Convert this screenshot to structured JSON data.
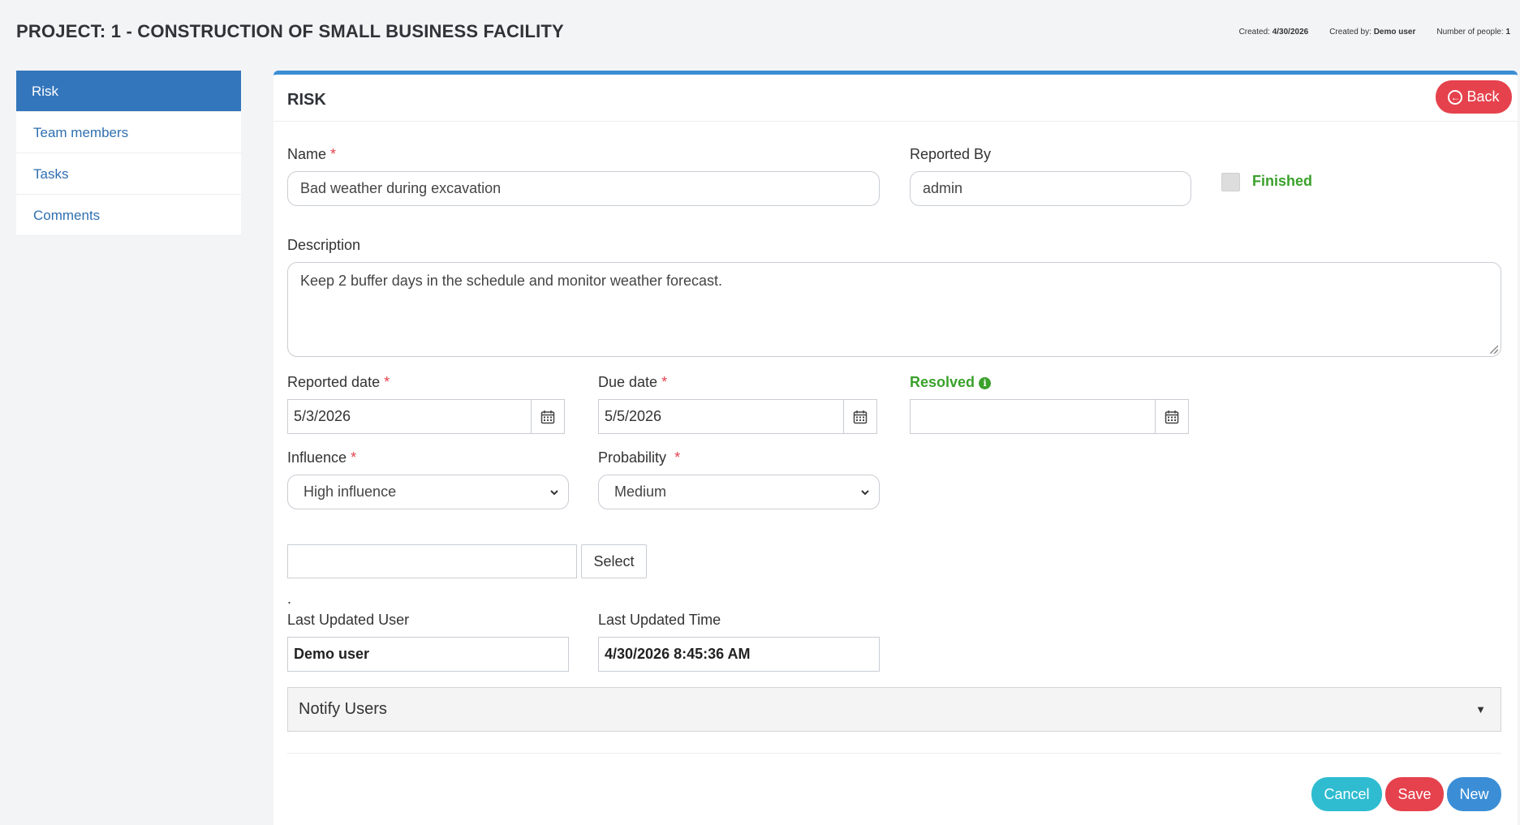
{
  "page": {
    "title": "PROJECT: 1 - CONSTRUCTION OF SMALL BUSINESS FACILITY",
    "meta": {
      "created_label": "Created:",
      "created_value": "4/30/2026",
      "created_by_label": "Created by:",
      "created_by_value": "Demo user",
      "people_label": "Number of people:",
      "people_value": "1"
    }
  },
  "sidebar": {
    "items": [
      {
        "label": "Risk",
        "active": true
      },
      {
        "label": "Team members",
        "active": false
      },
      {
        "label": "Tasks",
        "active": false
      },
      {
        "label": "Comments",
        "active": false
      }
    ]
  },
  "card": {
    "title": "RISK",
    "back_label": "Back"
  },
  "form": {
    "name": {
      "label": "Name",
      "value": "Bad weather during excavation"
    },
    "reported_by": {
      "label": "Reported By",
      "value": "admin"
    },
    "finished": {
      "label": "Finished",
      "checked": false
    },
    "description": {
      "label": "Description",
      "value": "Keep 2 buffer days in the schedule and monitor weather forecast."
    },
    "reported_date": {
      "label": "Reported date",
      "value": "5/3/2026"
    },
    "due_date": {
      "label": "Due date",
      "value": "5/5/2026"
    },
    "resolved": {
      "label": "Resolved",
      "value": ""
    },
    "influence": {
      "label": "Influence",
      "value": "High influence"
    },
    "probability": {
      "label": "Probability",
      "value": "Medium"
    },
    "select_button": "Select",
    "dot": ".",
    "last_updated_user": {
      "label": "Last Updated User",
      "value": "Demo user"
    },
    "last_updated_time": {
      "label": "Last Updated Time",
      "value": "4/30/2026 8:45:36 AM"
    },
    "notify_users": "Notify Users",
    "required_mark": "*"
  },
  "actions": {
    "cancel": "Cancel",
    "save": "Save",
    "new": "New"
  },
  "colors": {
    "primary": "#3476bc",
    "danger": "#e5424d",
    "info": "#2fbcd0",
    "success": "#3aa12b"
  }
}
